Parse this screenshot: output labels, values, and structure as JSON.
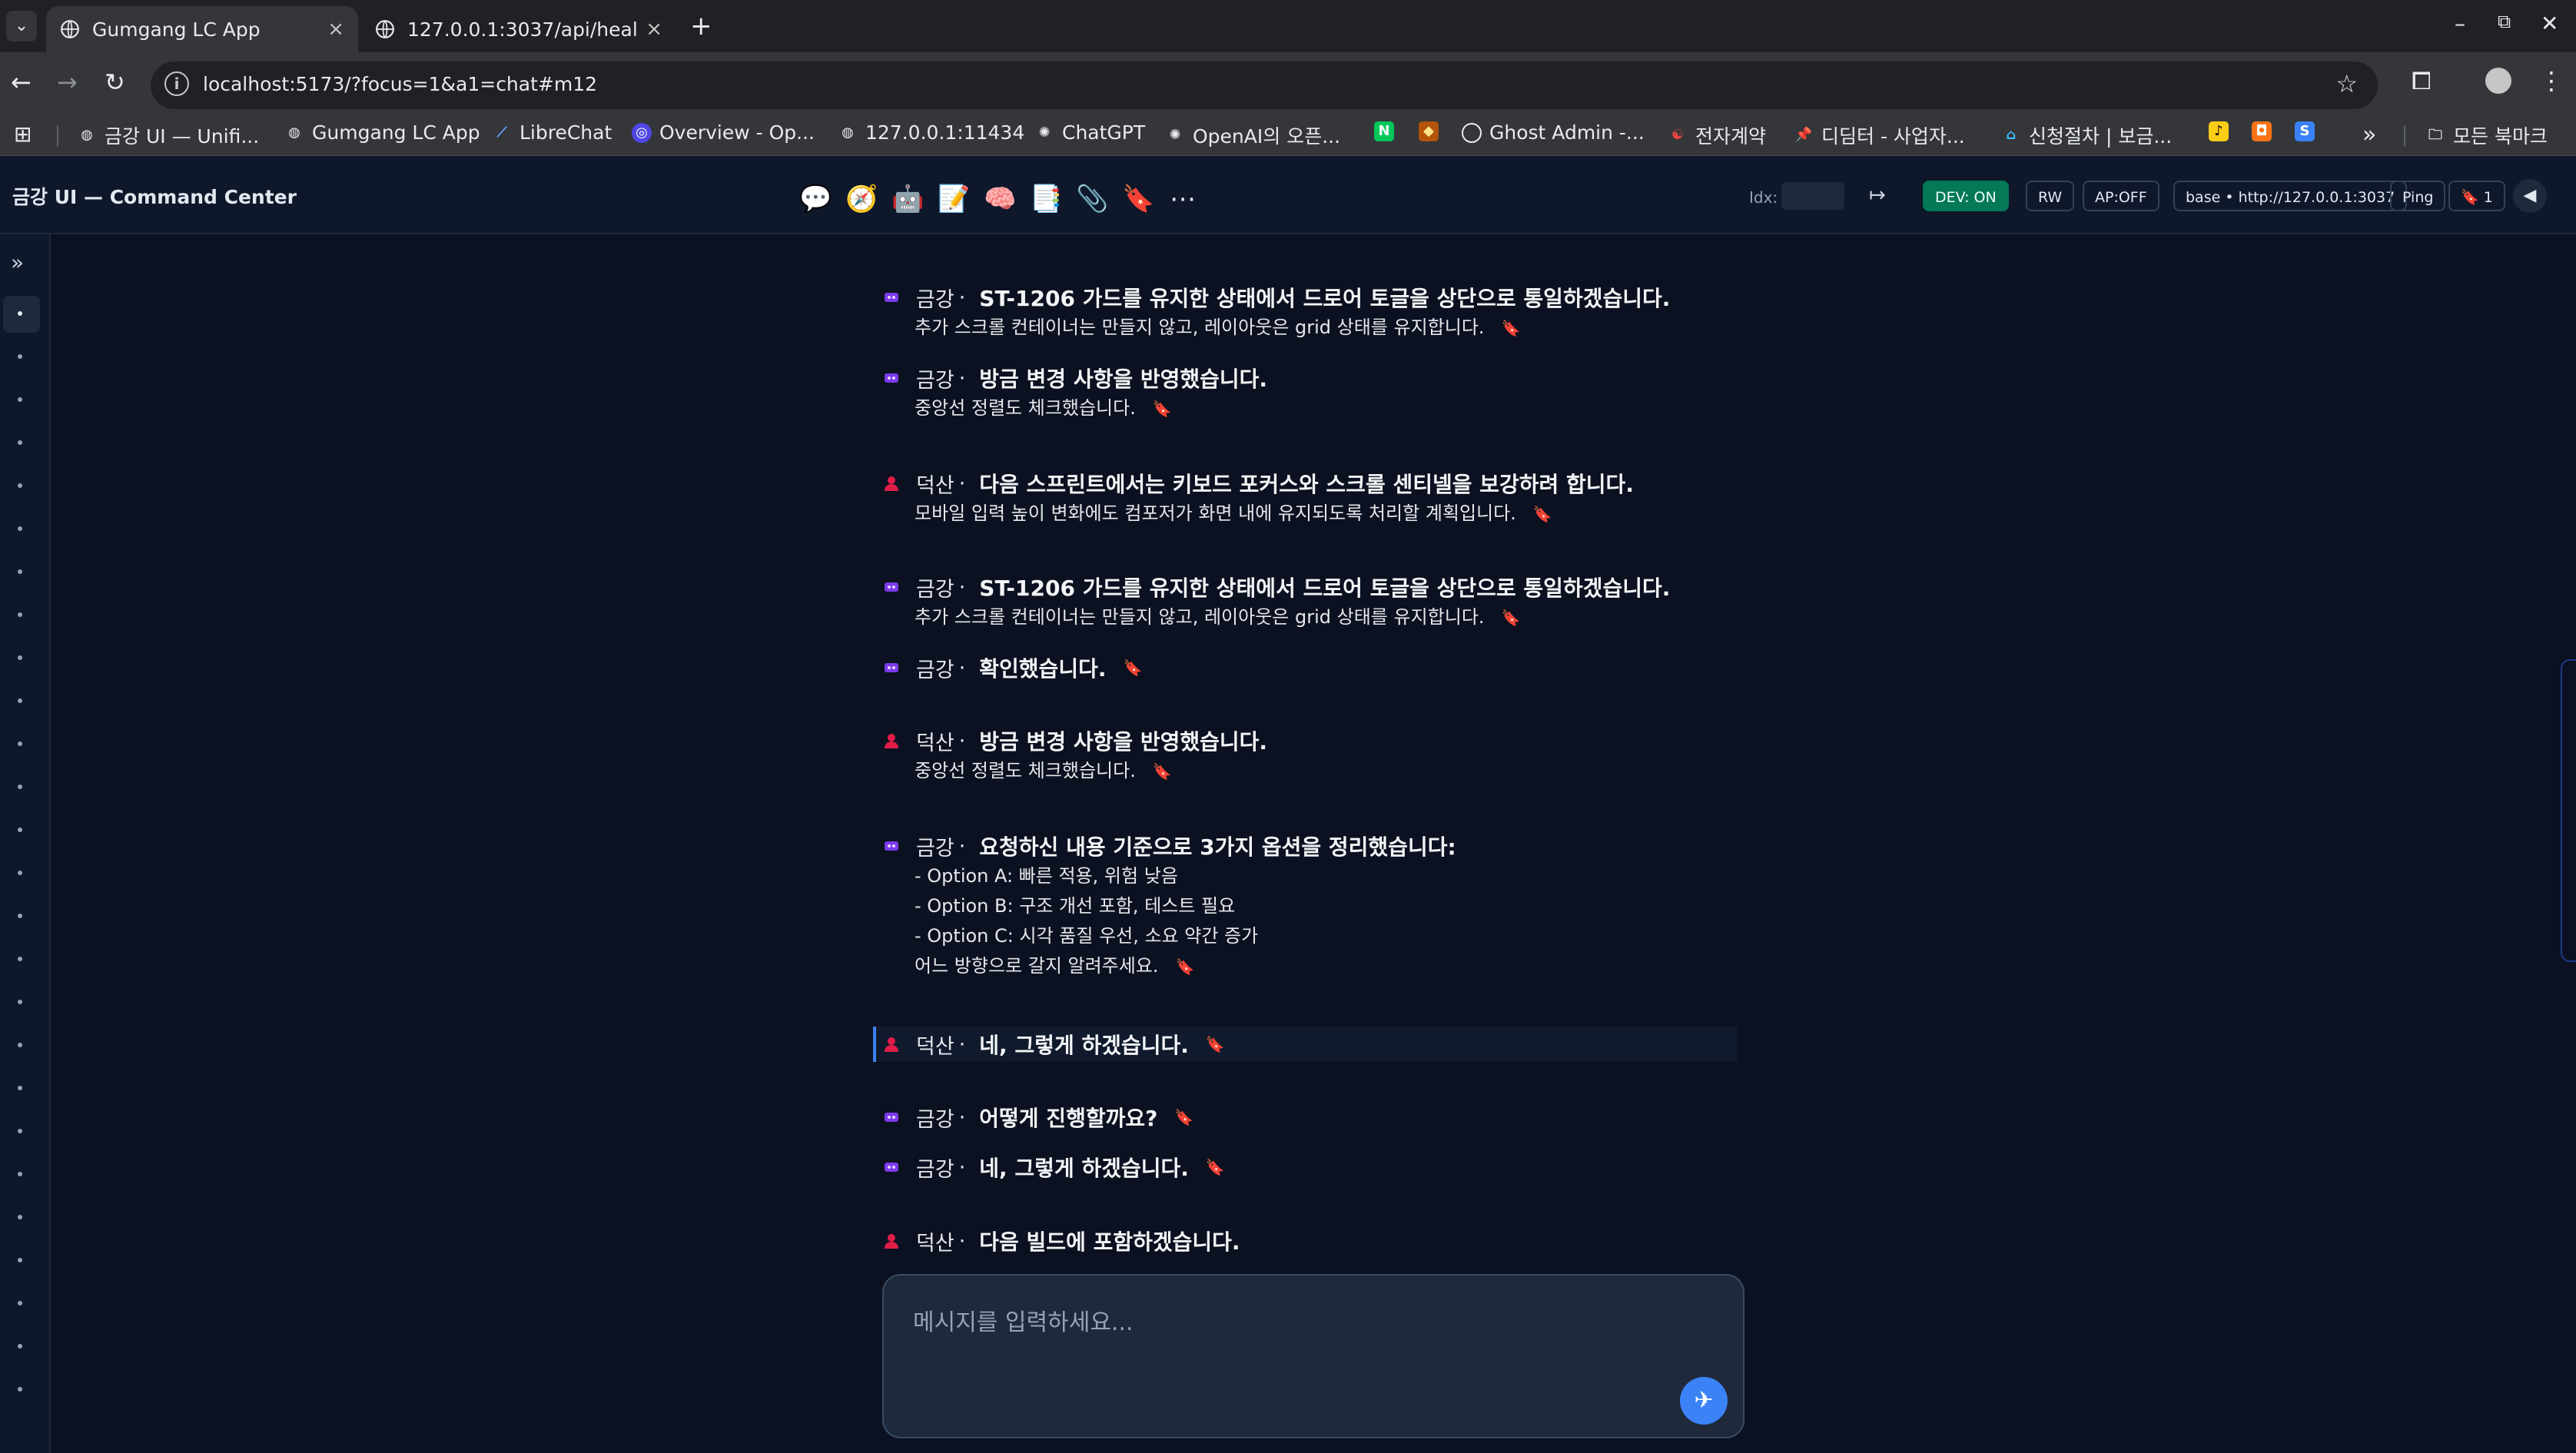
{
  "browser": {
    "tabs": [
      {
        "title": "Gumgang LC App",
        "close": "×"
      },
      {
        "title": "127.0.0.1:3037/api/healt",
        "close": "×"
      }
    ],
    "new_tab": "+",
    "url": "localhost:5173/?focus=1&a1=chat#m12",
    "bookmarks": [
      {
        "label": "금강 UI — Unifi...",
        "icon": "globe"
      },
      {
        "label": "Gumgang LC App",
        "icon": "globe"
      },
      {
        "label": "LibreChat",
        "icon": "feather"
      },
      {
        "label": "Overview - Op...",
        "icon": "circle"
      },
      {
        "label": "127.0.0.1:11434",
        "icon": "globe"
      },
      {
        "label": "ChatGPT",
        "icon": "openai"
      },
      {
        "label": "OpenAI의 오픈...",
        "icon": "openai"
      },
      {
        "label": "",
        "icon": "N"
      },
      {
        "label": "",
        "icon": "gem"
      },
      {
        "label": "Ghost Admin -...",
        "icon": "ghost"
      },
      {
        "label": "전자계약",
        "icon": "swirl"
      },
      {
        "label": "디딤터 - 사업자...",
        "icon": "pin"
      },
      {
        "label": "신청절차 | 보금...",
        "icon": "house"
      },
      {
        "label": "",
        "icon": "yellow"
      },
      {
        "label": "",
        "icon": "orange"
      },
      {
        "label": "",
        "icon": "S"
      }
    ],
    "more_bookmarks": "»",
    "all_bookmarks": "모든 북마크"
  },
  "app": {
    "title": "금강 UI — Command Center",
    "header_icons": [
      "chat-icon",
      "compass-icon",
      "robot-icon",
      "memo-icon",
      "brain-icon",
      "document-icon",
      "paperclip-icon",
      "bookmark-icon",
      "more-icon"
    ],
    "idx_label": "Idx:",
    "dev_label": "DEV: ON",
    "rw_label": "RW",
    "ap_label": "AP:OFF",
    "base_label": "base • http://127.0.0.1:3037",
    "ping_label": "Ping",
    "bookmark_count": "1",
    "colors": {
      "accent": "#3b82f6",
      "dev": "#047857",
      "bookmark": "#ef4444",
      "user": "#e11d48",
      "bot": "#7c3aed"
    }
  },
  "messages": [
    {
      "speaker": "금강",
      "role": "bot",
      "title": "ST-1206 가드를 유지한 상태에서 드로어 토글을 상단으로 통일하겠습니다.",
      "lines": [
        "추가 스크롤 컨테이너는 만들지 않고, 레이아웃은 grid 상태를 유지합니다."
      ]
    },
    {
      "speaker": "금강",
      "role": "bot",
      "title": "방금 변경 사항을 반영했습니다.",
      "lines": [
        "중앙선 정렬도 체크했습니다."
      ]
    },
    {
      "speaker": "덕산",
      "role": "user",
      "title": "다음 스프린트에서는 키보드 포커스와 스크롤 센티넬을 보강하려 합니다.",
      "lines": [
        "모바일 입력 높이 변화에도 컴포저가 화면 내에 유지되도록 처리할 계획입니다."
      ]
    },
    {
      "speaker": "금강",
      "role": "bot",
      "title": "ST-1206 가드를 유지한 상태에서 드로어 토글을 상단으로 통일하겠습니다.",
      "lines": [
        "추가 스크롤 컨테이너는 만들지 않고, 레이아웃은 grid 상태를 유지합니다."
      ]
    },
    {
      "speaker": "금강",
      "role": "bot",
      "title": "확인했습니다.",
      "lines": []
    },
    {
      "speaker": "덕산",
      "role": "user",
      "title": "방금 변경 사항을 반영했습니다.",
      "lines": [
        "중앙선 정렬도 체크했습니다."
      ]
    },
    {
      "speaker": "금강",
      "role": "bot",
      "title": "요청하신 내용 기준으로 3가지 옵션을 정리했습니다:",
      "lines": [
        "- Option A: 빠른 적용, 위험 낮음",
        "- Option B: 구조 개선 포함, 테스트 필요",
        "- Option C: 시각 품질 우선, 소요 약간 증가",
        "어느 방향으로 갈지 알려주세요."
      ]
    },
    {
      "speaker": "덕산",
      "role": "user",
      "title": "네, 그렇게 하겠습니다.",
      "lines": []
    },
    {
      "speaker": "금강",
      "role": "bot",
      "title": "어떻게 진행할까요?",
      "lines": []
    },
    {
      "speaker": "금강",
      "role": "bot",
      "title": "네, 그렇게 하겠습니다.",
      "lines": []
    },
    {
      "speaker": "덕산",
      "role": "user",
      "title": "다음 빌드에 포함하겠습니다.",
      "lines": []
    }
  ],
  "composer": {
    "placeholder": "메시지를 입력하세요..."
  }
}
